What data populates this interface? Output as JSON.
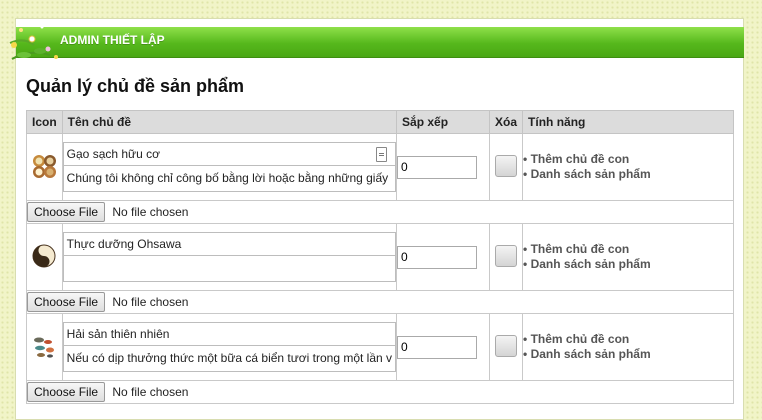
{
  "header": {
    "title": "ADMIN THIẾT LẬP"
  },
  "page_title": "Quản lý chủ đề sản phẩm",
  "columns": {
    "icon": "Icon",
    "name": "Tên chủ đề",
    "sort": "Sắp xếp",
    "delete": "Xóa",
    "features": "Tính năng"
  },
  "rows": [
    {
      "name": "Gạo sạch hữu cơ",
      "description": "Chúng tôi không chỉ công bố bằng lời hoặc bằng những giấy",
      "sort": "0",
      "icon": "rice-bowls-icon"
    },
    {
      "name": "Thực dưỡng Ohsawa",
      "description": "",
      "sort": "0",
      "icon": "yin-yang-icon"
    },
    {
      "name": "Hải sản thiên nhiên",
      "description": "Nếu có dịp thưởng thức một bữa cá biển tươi trong một lần v",
      "sort": "0",
      "icon": "seafood-icon"
    }
  ],
  "features": {
    "add_child": "• Thêm chủ đề con",
    "product_list": "• Danh sách sản phẩm"
  },
  "file": {
    "choose": "Choose File",
    "none": "No file chosen"
  },
  "colors": {
    "header_green": "#56b81c",
    "background": "#f1f4c8"
  }
}
